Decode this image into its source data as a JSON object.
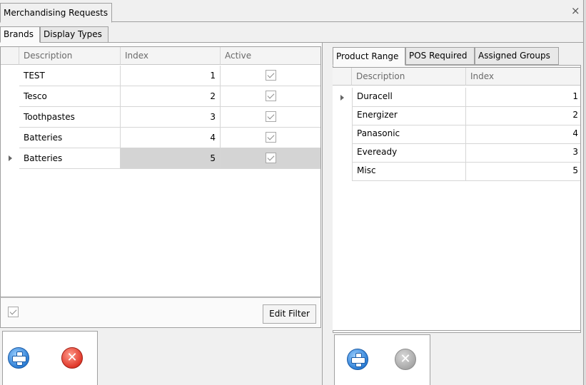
{
  "window": {
    "tab_title": "Merchandising Requests",
    "close_glyph": "×"
  },
  "left_tabs": [
    "Brands",
    "Display Types"
  ],
  "brands_grid": {
    "columns": [
      "Description",
      "Index",
      "Active"
    ],
    "rows": [
      {
        "description": "TEST",
        "index": "1",
        "active": true
      },
      {
        "description": "Tesco",
        "index": "2",
        "active": true
      },
      {
        "description": "Toothpastes",
        "index": "3",
        "active": true
      },
      {
        "description": "Batteries",
        "index": "4",
        "active": true
      },
      {
        "description": "Batteries",
        "index": "5",
        "active": true,
        "selected": true
      }
    ],
    "filter_checked": true,
    "edit_filter_label": "Edit Filter"
  },
  "right_tabs": [
    "Product Range",
    "POS Required",
    "Assigned Groups"
  ],
  "product_grid": {
    "columns": [
      "Description",
      "Index"
    ],
    "rows": [
      {
        "description": "Duracell",
        "index": "1",
        "current": true
      },
      {
        "description": "Energizer",
        "index": "2"
      },
      {
        "description": "Panasonic",
        "index": "4"
      },
      {
        "description": "Eveready",
        "index": "3"
      },
      {
        "description": "Misc",
        "index": "5"
      }
    ]
  },
  "icons": {
    "add": "plus-circle-icon",
    "delete": "x-circle-icon"
  },
  "colors": {
    "selected_row": "#d4d4d4",
    "add_blue": "#2d7fd6",
    "delete_red": "#e0382a"
  }
}
